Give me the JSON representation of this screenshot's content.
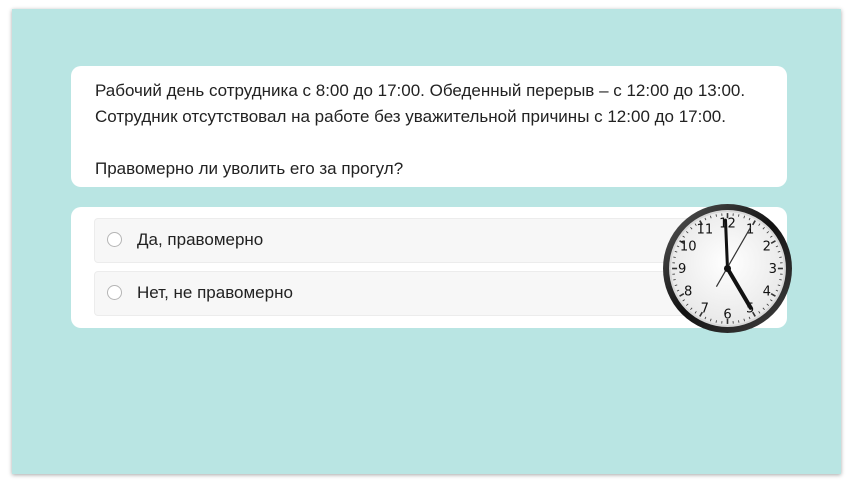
{
  "question": {
    "line1": "Рабочий день сотрудника с 8:00 до 17:00. Обеденный перерыв – с 12:00 до 13:00.",
    "line2": "Сотрудник отсутствовал на работе без уважительной причины с 12:00 до 17:00.",
    "line3": "Правомерно ли  уволить его  за прогул?"
  },
  "options": [
    {
      "label": "Да, правомерно",
      "selected": false
    },
    {
      "label": "Нет, не правомерно",
      "selected": false
    }
  ],
  "clock": {
    "numbers": [
      "12",
      "1",
      "2",
      "3",
      "4",
      "5",
      "6",
      "7",
      "8",
      "9",
      "10",
      "11"
    ]
  },
  "colors": {
    "background": "#b9e5e3",
    "card": "#ffffff",
    "option_bg": "#f7f7f7"
  }
}
